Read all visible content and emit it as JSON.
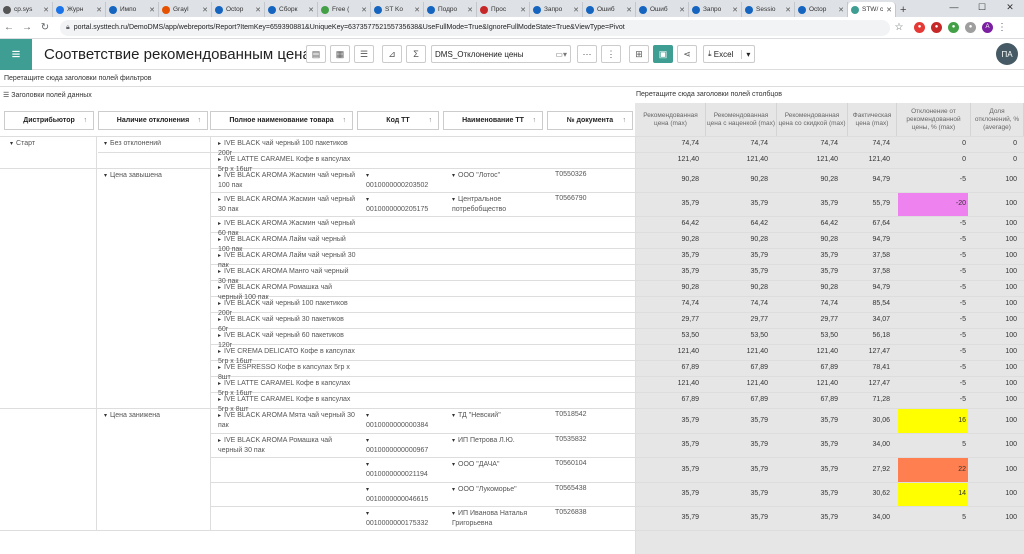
{
  "browser": {
    "tabs": [
      {
        "label": "cp.sys",
        "color": "#555"
      },
      {
        "label": "Журн",
        "color": "#1a73e8"
      },
      {
        "label": "Импо",
        "color": "#1565c0"
      },
      {
        "label": "Grayl",
        "color": "#e65100"
      },
      {
        "label": "Octop",
        "color": "#1565c0"
      },
      {
        "label": "Сборк",
        "color": "#1565c0"
      },
      {
        "label": "Free (",
        "color": "#43a047"
      },
      {
        "label": "ST Ko",
        "color": "#1565c0"
      },
      {
        "label": "Подро",
        "color": "#1565c0"
      },
      {
        "label": "Прос",
        "color": "#c62828"
      },
      {
        "label": "Запро",
        "color": "#1565c0"
      },
      {
        "label": "Ошиб",
        "color": "#1565c0"
      },
      {
        "label": "Ошиб",
        "color": "#1565c0"
      },
      {
        "label": "Запро",
        "color": "#1565c0"
      },
      {
        "label": "Sessio",
        "color": "#1565c0"
      },
      {
        "label": "Octop",
        "color": "#1565c0"
      },
      {
        "label": "STW/ с",
        "color": "#3f9e93",
        "active": true
      }
    ],
    "url": "portal.systtech.ru/DemoDMS/app/webreports/Report?ItemKey=659390881&UniqueKey=637357752155735638&UseFullMode=True&IgnoreFullModeState=True&ViewType=Pivot"
  },
  "header": {
    "title": "Соответствие рекомендованным ценам",
    "layout_name": "DMS_Отклонение цены",
    "excel_label": "Excel",
    "avatar": "ПА"
  },
  "pivot": {
    "filter_area": "Перетащите сюда заголовки полей фильтров",
    "data_area": "Заголовки полей данных",
    "column_area": "Перетащите сюда заголовки полей столбцов",
    "row_fields": [
      "Дистрибьютор",
      "Наличие отклонения",
      "Полное наименование товара",
      "Код ТТ",
      "Наименование ТТ",
      "№ документа"
    ],
    "data_fields": [
      "Рекомендованная цена (max)",
      "Рекомендованная цена с наценкой (max)",
      "Рекомендованная цена со скидкой (max)",
      "Фактическая цена (max)",
      "Отклонение от рекомендованной цены, % (max)",
      "Доля отклонений, % (average)"
    ],
    "groups": {
      "distributor": "Старт",
      "no_dev": "Без отклонений",
      "over": "Цена завышена",
      "under": "Цена занижена"
    },
    "rows": [
      {
        "product": "IVE BLACK чай черный 100 пакетиков 200г",
        "code": "",
        "tt": "",
        "doc": "",
        "v": [
          "74,74",
          "74,74",
          "74,74",
          "74,74",
          "0",
          "0"
        ]
      },
      {
        "product": "IVE LATTE CARAMEL Кофе в капсулах 5гр x 16шт",
        "code": "",
        "tt": "",
        "doc": "",
        "v": [
          "121,40",
          "121,40",
          "121,40",
          "121,40",
          "0",
          "0"
        ]
      },
      {
        "product": "IVE BLACK AROMA Жасмин чай черный 100 пак",
        "code": "0010000000203502",
        "tt": "ООО \"Лотос\"",
        "doc": "Т0550326",
        "v": [
          "90,28",
          "90,28",
          "90,28",
          "94,79",
          "-5",
          "100"
        ]
      },
      {
        "product": "IVE BLACK AROMA Жасмин чай черный 30 пак",
        "code": "0010000000205175",
        "tt": "Центральное потребобщество",
        "doc": "Т0566790",
        "v": [
          "35,79",
          "35,79",
          "35,79",
          "55,79",
          "-20",
          "100"
        ]
      },
      {
        "product": "IVE BLACK AROMA Жасмин чай черный 60 пак",
        "code": "",
        "tt": "",
        "doc": "",
        "v": [
          "64,42",
          "64,42",
          "64,42",
          "67,64",
          "-5",
          "100"
        ]
      },
      {
        "product": "IVE BLACK AROMA Лайм чай черный 100 пак",
        "code": "",
        "tt": "",
        "doc": "",
        "v": [
          "90,28",
          "90,28",
          "90,28",
          "94,79",
          "-5",
          "100"
        ]
      },
      {
        "product": "IVE BLACK AROMA Лайм чай черный 30 пак",
        "code": "",
        "tt": "",
        "doc": "",
        "v": [
          "35,79",
          "35,79",
          "35,79",
          "37,58",
          "-5",
          "100"
        ]
      },
      {
        "product": "IVE BLACK AROMA Манго чай черный 30 пак",
        "code": "",
        "tt": "",
        "doc": "",
        "v": [
          "35,79",
          "35,79",
          "35,79",
          "37,58",
          "-5",
          "100"
        ]
      },
      {
        "product": "IVE BLACK AROMA Ромашка чай черный 100 пак",
        "code": "",
        "tt": "",
        "doc": "",
        "v": [
          "90,28",
          "90,28",
          "90,28",
          "94,79",
          "-5",
          "100"
        ]
      },
      {
        "product": "IVE BLACK чай черный 100 пакетиков 200г",
        "code": "",
        "tt": "",
        "doc": "",
        "v": [
          "74,74",
          "74,74",
          "74,74",
          "85,54",
          "-5",
          "100"
        ]
      },
      {
        "product": "IVE BLACK чай черный 30 пакетиков 60г",
        "code": "",
        "tt": "",
        "doc": "",
        "v": [
          "29,77",
          "29,77",
          "29,77",
          "34,07",
          "-5",
          "100"
        ]
      },
      {
        "product": "IVE BLACK чай черный 60 пакетиков 120г",
        "code": "",
        "tt": "",
        "doc": "",
        "v": [
          "53,50",
          "53,50",
          "53,50",
          "56,18",
          "-5",
          "100"
        ]
      },
      {
        "product": "IVE CREMA DELICATO Кофе в капсулах 5гр x 16шт",
        "code": "",
        "tt": "",
        "doc": "",
        "v": [
          "121,40",
          "121,40",
          "121,40",
          "127,47",
          "-5",
          "100"
        ]
      },
      {
        "product": "IVE ESPRESSO Кофе в капсулах 5гр x 8шт",
        "code": "",
        "tt": "",
        "doc": "",
        "v": [
          "67,89",
          "67,89",
          "67,89",
          "78,41",
          "-5",
          "100"
        ]
      },
      {
        "product": "IVE LATTE CARAMEL Кофе в капсулах 5гр x 16шт",
        "code": "",
        "tt": "",
        "doc": "",
        "v": [
          "121,40",
          "121,40",
          "121,40",
          "127,47",
          "-5",
          "100"
        ]
      },
      {
        "product": "IVE LATTE CARAMEL Кофе в капсулах 5гр x 8шт",
        "code": "",
        "tt": "",
        "doc": "",
        "v": [
          "67,89",
          "67,89",
          "67,89",
          "71,28",
          "-5",
          "100"
        ]
      },
      {
        "product": "IVE BLACK AROMA Мята чай черный 30 пак",
        "code": "0010000000000384",
        "tt": "ТД \"Невский\"",
        "doc": "Т0518542",
        "v": [
          "35,79",
          "35,79",
          "35,79",
          "30,06",
          "16",
          "100"
        ]
      },
      {
        "product": "IVE BLACK AROMA Ромашка чай черный 30 пак",
        "code": "0010000000000967",
        "tt": "ИП Петрова Л.Ю.",
        "doc": "Т0535832",
        "v": [
          "35,79",
          "35,79",
          "35,79",
          "34,00",
          "5",
          "100"
        ]
      },
      {
        "product": "",
        "code": "0010000000021194",
        "tt": "ООО \"ДАЧА\"",
        "doc": "Т0560104",
        "v": [
          "35,79",
          "35,79",
          "35,79",
          "27,92",
          "22",
          "100"
        ]
      },
      {
        "product": "",
        "code": "0010000000046615",
        "tt": "ООО \"Лукоморье\"",
        "doc": "Т0565438",
        "v": [
          "35,79",
          "35,79",
          "35,79",
          "30,62",
          "14",
          "100"
        ]
      },
      {
        "product": "",
        "code": "0010000000175332",
        "tt": "ИП Иванова Наталья Григорьевна",
        "doc": "Т0526838",
        "v": [
          "35,79",
          "35,79",
          "35,79",
          "34,00",
          "5",
          "100"
        ]
      }
    ],
    "highlight_colors": {
      "magenta": "#ee82ee",
      "yellow": "#ffff00",
      "orange": "#ff7f50"
    }
  }
}
